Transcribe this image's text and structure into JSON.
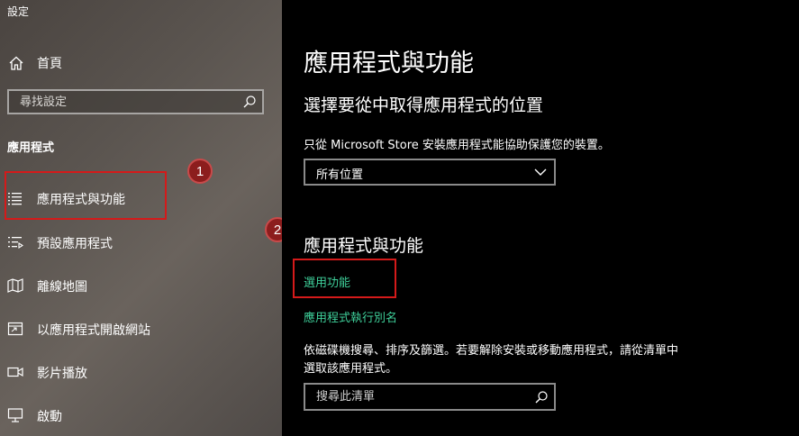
{
  "window": {
    "title": "設定"
  },
  "sidebar": {
    "home_label": "首頁",
    "search_placeholder": "尋找設定",
    "section_header": "應用程式",
    "items": [
      {
        "label": "應用程式與功能",
        "icon": "apps-list-icon",
        "selected": true
      },
      {
        "label": "預設應用程式",
        "icon": "default-apps-icon",
        "selected": false
      },
      {
        "label": "離線地圖",
        "icon": "offline-map-icon",
        "selected": false
      },
      {
        "label": "以應用程式開啟網站",
        "icon": "open-with-icon",
        "selected": false
      },
      {
        "label": "影片播放",
        "icon": "video-icon",
        "selected": false
      },
      {
        "label": "啟動",
        "icon": "startup-icon",
        "selected": false
      }
    ]
  },
  "main": {
    "page_title": "應用程式與功能",
    "choose_location": {
      "title": "選擇要從中取得應用程式的位置",
      "description": "只從 Microsoft Store 安裝應用程式能協助保護您的裝置。",
      "selected_option": "所有位置"
    },
    "apps_section": {
      "title": "應用程式與功能",
      "optional_features_link": "選用功能",
      "aliases_link": "應用程式執行別名",
      "description_line1": "依磁碟機搜尋、排序及篩選。若要解除安裝或移動應用程式，請從清單中",
      "description_line2": "選取該應用程式。",
      "search_placeholder": "搜尋此清單"
    }
  },
  "annotations": {
    "badge1": "1",
    "badge2": "2",
    "highlight_color": "#d41a1a"
  },
  "colors": {
    "accent": "#00d3a4",
    "link": "#3fd19b"
  }
}
